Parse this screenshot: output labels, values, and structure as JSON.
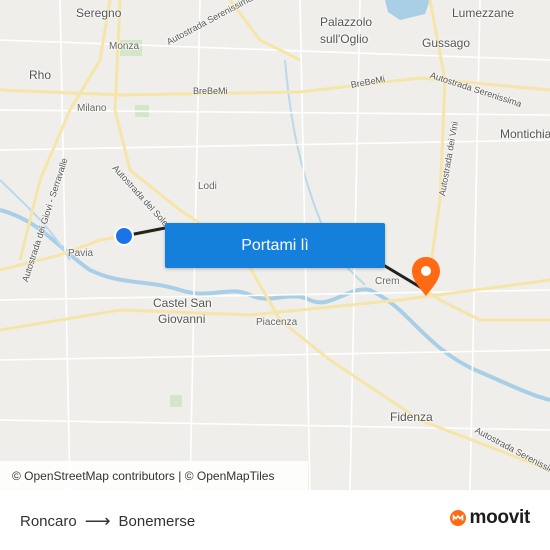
{
  "map": {
    "labels": {
      "seregno": "Seregno",
      "monza": "Monza",
      "rho": "Rho",
      "milano": "Milano",
      "palazzolo": "Palazzolo",
      "sull_oglio": "sull'Oglio",
      "gussago": "Gussago",
      "lumezzane": "Lumezzane",
      "montichiari": "Montichia",
      "lodi": "Lodi",
      "pavia": "Pavia",
      "castel_san": "Castel San",
      "giovanni": "Giovanni",
      "piacenza": "Piacenza",
      "cremona": "Crem",
      "fidenza": "Fidenza",
      "road_serenissima_1": "Autostrada Serenissima",
      "road_serenissima_2": "Autostrada Serenissima",
      "road_serenissima_3": "Autostrada Serenissima",
      "road_brebemi_1": "BreBeMi",
      "road_brebemi_2": "BreBeMi",
      "road_sole": "Autostrada del Sole",
      "road_giovi": "Autostrada dei Giovi - Serravalle",
      "road_vini": "Autostrada dei Vini"
    },
    "attribution": "© OpenStreetMap contributors | © OpenMapTiles",
    "cta_label": "Portami lì",
    "origin_marker_color": "#1a73e8",
    "destination_marker_color": "#ff6a13",
    "route_color": "#222222"
  },
  "footer": {
    "origin": "Roncaro",
    "destination": "Bonemerse",
    "brand": "moovit",
    "brand_color": "#ff6a13"
  }
}
